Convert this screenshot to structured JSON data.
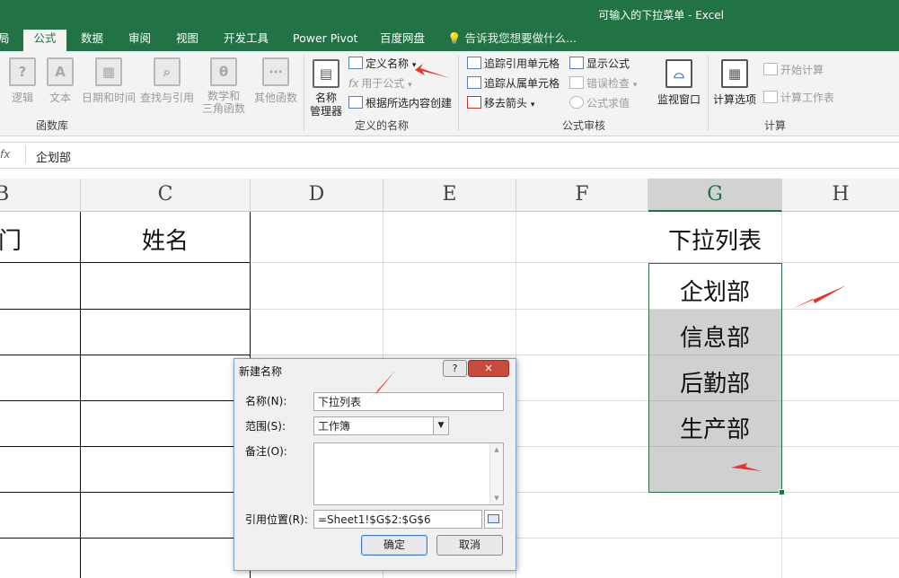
{
  "window": {
    "title": "可输入的下拉菜单 - Excel"
  },
  "tabs": [
    {
      "label": "局",
      "active": false
    },
    {
      "label": "公式",
      "active": true
    },
    {
      "label": "数据",
      "active": false
    },
    {
      "label": "审阅",
      "active": false
    },
    {
      "label": "视图",
      "active": false
    },
    {
      "label": "开发工具",
      "active": false
    },
    {
      "label": "Power Pivot",
      "active": false
    },
    {
      "label": "百度网盘",
      "active": false
    }
  ],
  "tell_me": "告诉我您想要做什么...",
  "ribbon": {
    "function_library": {
      "label": "函数库",
      "buttons": [
        "逻辑",
        "文本",
        "日期和时间",
        "查找与引用",
        "数学和",
        "三角函数",
        "其他函数"
      ]
    },
    "defined_names": {
      "label": "定义的名称",
      "name_manager": [
        "名称",
        "管理器"
      ],
      "define_name": "定义名称",
      "use_in_formula": "用于公式",
      "create_from_selection": "根据所选内容创建"
    },
    "formula_auditing": {
      "label": "公式审核",
      "trace_precedents": "追踪引用单元格",
      "trace_dependents": "追踪从属单元格",
      "remove_arrows": "移去箭头",
      "show_formulas": "显示公式",
      "error_checking": "错误检查",
      "evaluate_formula": "公式求值",
      "watch_window": "监视窗口"
    },
    "calculation": {
      "label": "计算",
      "options": "计算选项",
      "calc_now": "开始计算",
      "calc_sheet": "计算工作表"
    }
  },
  "formula_bar": {
    "fx": "fx",
    "value": "企划部"
  },
  "columns": [
    "B",
    "C",
    "D",
    "E",
    "F",
    "G",
    "H"
  ],
  "cells": {
    "b_header": "门",
    "c_header": "姓名",
    "g_header": "下拉列表",
    "g_list": [
      "企划部",
      "信息部",
      "后勤部",
      "生产部"
    ]
  },
  "dialog": {
    "title": "新建名称",
    "help": "?",
    "close": "✕",
    "name_label": "名称(N):",
    "name_value": "下拉列表",
    "scope_label": "范围(S):",
    "scope_value": "工作簿",
    "comment_label": "备注(O):",
    "ref_label": "引用位置(R):",
    "ref_value": "=Sheet1!$G$2:$G$6",
    "ok": "确定",
    "cancel": "取消"
  },
  "colors": {
    "excel_green": "#217346",
    "annotation_red": "#e8312a",
    "selection_gray": "#d0d0d0"
  }
}
